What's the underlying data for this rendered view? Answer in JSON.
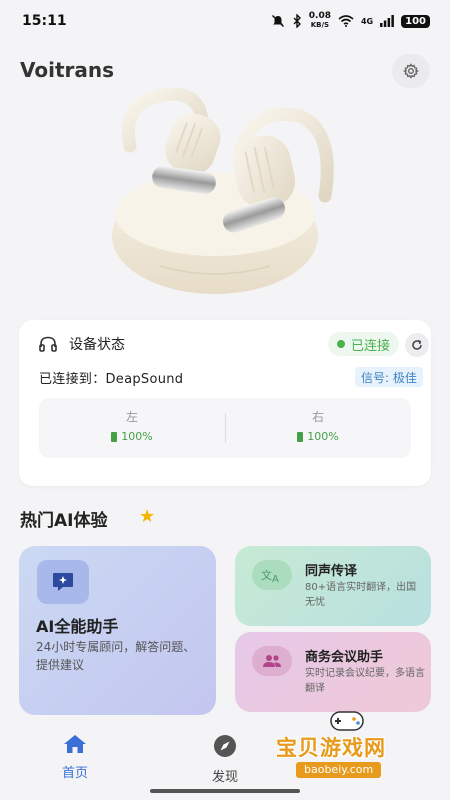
{
  "status_bar": {
    "time": "15:11",
    "net_speed_value": "0.08",
    "net_speed_unit": "KB/S",
    "network_type": "4G",
    "battery": "100"
  },
  "header": {
    "title": "Voitrans"
  },
  "device_card": {
    "title": "设备状态",
    "connection_status": "已连接",
    "connected_to": "已连接到：DeapSound",
    "signal": "信号: 极佳",
    "left_label": "左",
    "left_battery": "100%",
    "right_label": "右",
    "right_battery": "100%"
  },
  "section": {
    "title": "热门AI体验"
  },
  "features": {
    "assistant": {
      "title": "AI全能助手",
      "desc": "24小时专属顾问，解答问题、提供建议"
    },
    "translate": {
      "title": "同声传译",
      "desc": "80+语言实时翻译，出国无忧"
    },
    "meeting": {
      "title": "商务会议助手",
      "desc": "实时记录会议纪要，多语言翻译"
    }
  },
  "nav": {
    "home": "首页",
    "discover": "发现"
  },
  "watermark": {
    "text": "宝贝游戏网",
    "url": "baobeiy.com"
  },
  "colors": {
    "accent_blue": "#3a6fd8",
    "connected_green": "#4caf50",
    "star_yellow": "#f5b400"
  }
}
